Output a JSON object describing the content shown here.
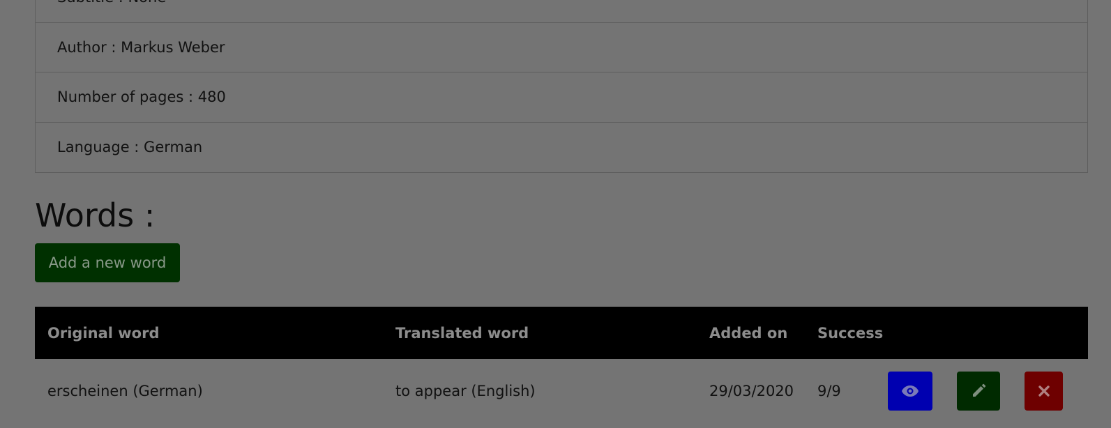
{
  "book_info": {
    "items": [
      {
        "label": "Subtitle : None"
      },
      {
        "label": "Author : Markus Weber"
      },
      {
        "label": "Number of pages : 480"
      },
      {
        "label": "Language : German"
      }
    ]
  },
  "words_section": {
    "title": "Words :",
    "add_button_label": "Add a new word"
  },
  "words_table": {
    "headers": {
      "original": "Original word",
      "translated": "Translated word",
      "added_on": "Added on",
      "success": "Success"
    },
    "rows": [
      {
        "original": "erscheinen (German)",
        "translated": "to appear (English)",
        "added_on": "29/03/2020",
        "success": "9/9",
        "actions": {
          "view_icon": "eye-icon",
          "edit_icon": "pencil-icon",
          "delete_icon": "close-icon"
        }
      }
    ]
  },
  "colors": {
    "overlay_background": "#747474",
    "view_button": "#0000b0",
    "edit_button": "#002a00",
    "delete_button": "#6e0000",
    "add_button": "#003000",
    "table_header": "#000000"
  }
}
